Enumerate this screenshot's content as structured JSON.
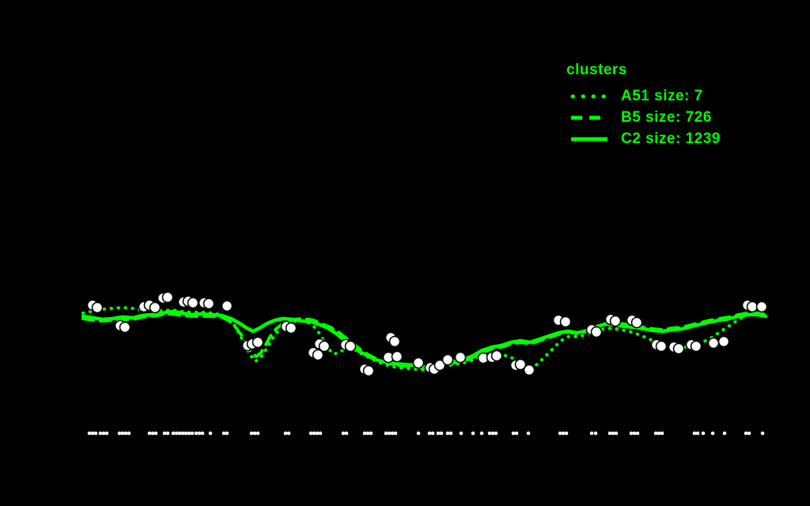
{
  "colors": {
    "background": "#000000",
    "series_green": "#00ff00",
    "scatter_fill": "#ffffff",
    "scatter_stroke": "#000000",
    "rug_fill": "#ffffff"
  },
  "legend": {
    "title": "clusters",
    "entries": [
      {
        "label": "A51 size: 7",
        "style": "dotted"
      },
      {
        "label": "B5 size: 726",
        "style": "dashed"
      },
      {
        "label": "C2 size: 1239",
        "style": "solid"
      }
    ]
  },
  "chart_data": {
    "type": "line",
    "title": "",
    "xlabel": "",
    "ylabel": "",
    "axes_visible": false,
    "grid": false,
    "legend_position": "top-right",
    "note": "No axis ticks or labels are visible; coordinates are canvas pixel positions (1024x640).",
    "series": [
      {
        "name": "A51",
        "size": 7,
        "style": "dotted",
        "width": 4,
        "dash": "0.5 8.5",
        "points": [
          [
            105,
            396
          ],
          [
            118,
            393
          ],
          [
            130,
            391
          ],
          [
            142,
            390
          ],
          [
            155,
            389
          ],
          [
            168,
            390
          ],
          [
            180,
            392
          ],
          [
            192,
            391
          ],
          [
            205,
            393
          ],
          [
            218,
            392
          ],
          [
            230,
            394
          ],
          [
            242,
            395
          ],
          [
            255,
            395
          ],
          [
            268,
            396
          ],
          [
            280,
            398
          ],
          [
            290,
            404
          ],
          [
            298,
            414
          ],
          [
            305,
            427
          ],
          [
            311,
            440
          ],
          [
            317,
            450
          ],
          [
            323,
            457
          ],
          [
            330,
            452
          ],
          [
            337,
            441
          ],
          [
            344,
            429
          ],
          [
            352,
            418
          ],
          [
            362,
            410
          ],
          [
            374,
            406
          ],
          [
            386,
            406
          ],
          [
            396,
            412
          ],
          [
            404,
            422
          ],
          [
            410,
            432
          ],
          [
            416,
            442
          ],
          [
            422,
            448
          ],
          [
            430,
            445
          ],
          [
            438,
            440
          ],
          [
            448,
            442
          ],
          [
            458,
            448
          ],
          [
            468,
            453
          ],
          [
            478,
            458
          ],
          [
            490,
            462
          ],
          [
            502,
            465
          ],
          [
            514,
            466
          ],
          [
            526,
            467
          ],
          [
            538,
            468
          ],
          [
            550,
            466
          ],
          [
            562,
            463
          ],
          [
            574,
            461
          ],
          [
            586,
            459
          ],
          [
            598,
            455
          ],
          [
            610,
            450
          ],
          [
            622,
            447
          ],
          [
            634,
            448
          ],
          [
            646,
            452
          ],
          [
            656,
            458
          ],
          [
            664,
            463
          ],
          [
            672,
            466
          ],
          [
            680,
            460
          ],
          [
            688,
            452
          ],
          [
            696,
            444
          ],
          [
            704,
            436
          ],
          [
            712,
            429
          ],
          [
            720,
            425
          ],
          [
            730,
            426
          ],
          [
            742,
            423
          ],
          [
            754,
            419
          ],
          [
            766,
            415
          ],
          [
            778,
            416
          ],
          [
            790,
            418
          ],
          [
            802,
            421
          ],
          [
            814,
            426
          ],
          [
            826,
            431
          ],
          [
            838,
            435
          ],
          [
            850,
            438
          ],
          [
            862,
            440
          ],
          [
            874,
            438
          ],
          [
            886,
            434
          ],
          [
            898,
            428
          ],
          [
            910,
            420
          ],
          [
            922,
            412
          ],
          [
            934,
            404
          ],
          [
            946,
            397
          ],
          [
            956,
            392
          ],
          [
            966,
            390
          ]
        ]
      },
      {
        "name": "B5",
        "size": 726,
        "style": "dashed",
        "width": 4,
        "dash": "13 9",
        "points": [
          [
            105,
            403
          ],
          [
            118,
            405
          ],
          [
            130,
            406
          ],
          [
            142,
            405
          ],
          [
            155,
            404
          ],
          [
            168,
            404
          ],
          [
            180,
            401
          ],
          [
            192,
            400
          ],
          [
            205,
            398
          ],
          [
            218,
            397
          ],
          [
            230,
            399
          ],
          [
            242,
            400
          ],
          [
            255,
            400
          ],
          [
            268,
            400
          ],
          [
            280,
            401
          ],
          [
            290,
            406
          ],
          [
            298,
            414
          ],
          [
            306,
            425
          ],
          [
            312,
            436
          ],
          [
            318,
            446
          ],
          [
            324,
            451
          ],
          [
            330,
            446
          ],
          [
            336,
            436
          ],
          [
            342,
            425
          ],
          [
            350,
            415
          ],
          [
            360,
            408
          ],
          [
            372,
            404
          ],
          [
            384,
            403
          ],
          [
            396,
            405
          ],
          [
            408,
            410
          ],
          [
            418,
            414
          ],
          [
            428,
            420
          ],
          [
            438,
            428
          ],
          [
            448,
            436
          ],
          [
            458,
            444
          ],
          [
            468,
            450
          ],
          [
            478,
            455
          ],
          [
            490,
            459
          ],
          [
            502,
            462
          ],
          [
            514,
            463
          ],
          [
            526,
            464
          ],
          [
            538,
            466
          ],
          [
            550,
            464
          ],
          [
            562,
            461
          ],
          [
            574,
            459
          ],
          [
            586,
            457
          ],
          [
            598,
            452
          ],
          [
            610,
            446
          ],
          [
            622,
            441
          ],
          [
            634,
            439
          ],
          [
            646,
            435
          ],
          [
            658,
            433
          ],
          [
            670,
            435
          ],
          [
            682,
            431
          ],
          [
            694,
            427
          ],
          [
            706,
            423
          ],
          [
            718,
            420
          ],
          [
            730,
            422
          ],
          [
            742,
            419
          ],
          [
            754,
            414
          ],
          [
            766,
            409
          ],
          [
            778,
            408
          ],
          [
            790,
            410
          ],
          [
            802,
            412
          ],
          [
            814,
            414
          ],
          [
            826,
            416
          ],
          [
            838,
            417
          ],
          [
            850,
            415
          ],
          [
            862,
            414
          ],
          [
            874,
            411
          ],
          [
            886,
            408
          ],
          [
            898,
            405
          ],
          [
            910,
            403
          ],
          [
            922,
            401
          ],
          [
            934,
            398
          ],
          [
            946,
            396
          ],
          [
            958,
            396
          ],
          [
            968,
            398
          ]
        ]
      },
      {
        "name": "C2",
        "size": 1239,
        "style": "solid",
        "width": 4.5,
        "dash": "",
        "points": [
          [
            105,
            400
          ],
          [
            118,
            402
          ],
          [
            130,
            404
          ],
          [
            142,
            403
          ],
          [
            155,
            401
          ],
          [
            168,
            402
          ],
          [
            180,
            399
          ],
          [
            192,
            398
          ],
          [
            205,
            396
          ],
          [
            218,
            394
          ],
          [
            230,
            396
          ],
          [
            242,
            398
          ],
          [
            255,
            397
          ],
          [
            268,
            398
          ],
          [
            280,
            399
          ],
          [
            292,
            403
          ],
          [
            303,
            409
          ],
          [
            312,
            415
          ],
          [
            320,
            419
          ],
          [
            328,
            415
          ],
          [
            338,
            409
          ],
          [
            348,
            405
          ],
          [
            358,
            403
          ],
          [
            370,
            404
          ],
          [
            382,
            406
          ],
          [
            394,
            407
          ],
          [
            405,
            411
          ],
          [
            415,
            415
          ],
          [
            425,
            422
          ],
          [
            435,
            430
          ],
          [
            445,
            438
          ],
          [
            455,
            445
          ],
          [
            465,
            450
          ],
          [
            475,
            455
          ],
          [
            487,
            458
          ],
          [
            500,
            460
          ],
          [
            512,
            461
          ],
          [
            525,
            462
          ],
          [
            538,
            464
          ],
          [
            550,
            462
          ],
          [
            562,
            459
          ],
          [
            574,
            457
          ],
          [
            586,
            455
          ],
          [
            598,
            450
          ],
          [
            610,
            443
          ],
          [
            622,
            439
          ],
          [
            634,
            437
          ],
          [
            646,
            433
          ],
          [
            658,
            431
          ],
          [
            670,
            433
          ],
          [
            682,
            429
          ],
          [
            694,
            425
          ],
          [
            706,
            421
          ],
          [
            718,
            419
          ],
          [
            730,
            421
          ],
          [
            742,
            418
          ],
          [
            754,
            413
          ],
          [
            766,
            410
          ],
          [
            778,
            411
          ],
          [
            790,
            413
          ],
          [
            802,
            414
          ],
          [
            814,
            416
          ],
          [
            826,
            418
          ],
          [
            838,
            419
          ],
          [
            850,
            417
          ],
          [
            862,
            416
          ],
          [
            874,
            413
          ],
          [
            886,
            410
          ],
          [
            898,
            407
          ],
          [
            910,
            405
          ],
          [
            922,
            403
          ],
          [
            934,
            400
          ],
          [
            946,
            398
          ],
          [
            958,
            398
          ],
          [
            968,
            400
          ]
        ]
      }
    ],
    "scatter": {
      "name": "points",
      "radius": 6.5,
      "points": [
        [
          117,
          386
        ],
        [
          123,
          389
        ],
        [
          152,
          412
        ],
        [
          158,
          414
        ],
        [
          182,
          388
        ],
        [
          189,
          386
        ],
        [
          196,
          389
        ],
        [
          206,
          377
        ],
        [
          212,
          376
        ],
        [
          232,
          382
        ],
        [
          238,
          381
        ],
        [
          244,
          383
        ],
        [
          258,
          383
        ],
        [
          264,
          384
        ],
        [
          287,
          387
        ],
        [
          313,
          437
        ],
        [
          319,
          435
        ],
        [
          326,
          433
        ],
        [
          362,
          413
        ],
        [
          368,
          415
        ],
        [
          396,
          446
        ],
        [
          402,
          449
        ],
        [
          404,
          435
        ],
        [
          410,
          438
        ],
        [
          437,
          436
        ],
        [
          443,
          438
        ],
        [
          461,
          467
        ],
        [
          466,
          469
        ],
        [
          494,
          427
        ],
        [
          499,
          432
        ],
        [
          491,
          452
        ],
        [
          502,
          451
        ],
        [
          529,
          459
        ],
        [
          544,
          465
        ],
        [
          549,
          467
        ],
        [
          556,
          462
        ],
        [
          566,
          455
        ],
        [
          582,
          452
        ],
        [
          611,
          453
        ],
        [
          622,
          452
        ],
        [
          628,
          450
        ],
        [
          652,
          462
        ],
        [
          658,
          461
        ],
        [
          669,
          468
        ],
        [
          706,
          405
        ],
        [
          715,
          407
        ],
        [
          748,
          417
        ],
        [
          754,
          420
        ],
        [
          772,
          404
        ],
        [
          778,
          406
        ],
        [
          799,
          405
        ],
        [
          805,
          408
        ],
        [
          830,
          436
        ],
        [
          836,
          438
        ],
        [
          852,
          439
        ],
        [
          858,
          441
        ],
        [
          874,
          436
        ],
        [
          880,
          438
        ],
        [
          902,
          434
        ],
        [
          915,
          432
        ],
        [
          945,
          386
        ],
        [
          951,
          388
        ],
        [
          963,
          388
        ]
      ]
    },
    "rug": {
      "y": 548,
      "radius": 2.3,
      "x": [
        113,
        117,
        121,
        127,
        131,
        135,
        151,
        155,
        159,
        163,
        189,
        193,
        197,
        208,
        212,
        219,
        223,
        227,
        231,
        235,
        239,
        243,
        248,
        252,
        256,
        266,
        283,
        287,
        318,
        322,
        326,
        361,
        365,
        393,
        397,
        401,
        405,
        434,
        438,
        461,
        465,
        469,
        488,
        492,
        496,
        500,
        529,
        543,
        547,
        554,
        558,
        566,
        570,
        583,
        598,
        609,
        619,
        623,
        627,
        649,
        653,
        668,
        708,
        712,
        716,
        748,
        753,
        771,
        775,
        779,
        798,
        802,
        806,
        829,
        833,
        837,
        878,
        882,
        889,
        901,
        916,
        943,
        947,
        964
      ]
    }
  }
}
